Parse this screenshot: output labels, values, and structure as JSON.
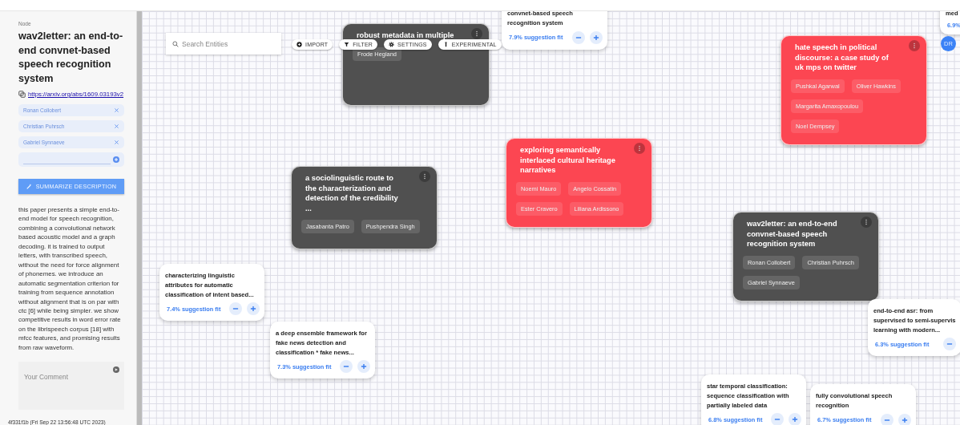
{
  "sidebar": {
    "label": "Node",
    "title": "wav2letter: an end-to-end convnet-based speech recognition system",
    "link": "https://arxiv.org/abs/1609.03193v2",
    "authors": [
      "Ronan Collobert",
      "Christian Puhrsch",
      "Gabriel Synnaeve"
    ],
    "summarize_button": "SUMMARIZE DESCRIPTION",
    "description": "this paper presents a simple end-to-end model for speech recognition, combining a convolutional network based acoustic model and a graph decoding. it is trained to output letters, with transcribed speech, without the need for force alignment of phonemes. we introduce an automatic segmentation criterion for training from sequence annotation without alignment that is on par with ctc [6] while being simpler. we show competitive results in word error rate on the librispeech corpus [18] with mfcc features, and promising results from raw waveform.",
    "comment_placeholder": "Your Comment"
  },
  "version": "4f331f1b (Fri Sep 22 13:56:48 UTC 2023)",
  "toolbar": {
    "search_placeholder": "Search Entities",
    "buttons": [
      {
        "kind": "import",
        "label": "IMPORT"
      },
      {
        "kind": "filter",
        "label": "FILTER"
      },
      {
        "kind": "settings",
        "label": "SETTINGS"
      },
      {
        "kind": "experimental",
        "label": "EXPERIMENTAL"
      }
    ]
  },
  "user_avatar": "DR",
  "nodes": [
    {
      "kind": "paper",
      "color": "#505050",
      "title": "robust metadata in multiple",
      "authors": [
        "Frode Hegland"
      ]
    },
    {
      "kind": "suggestion",
      "title": "convnet-based speech recognition system",
      "fit": "7.9% suggestion fit",
      "buttons": [
        {
          "kind": "minus"
        },
        {
          "kind": "plus"
        }
      ]
    },
    {
      "kind": "suggestion",
      "title": "med",
      "fit": "6.9%"
    },
    {
      "kind": "paper",
      "color": "#fc4652",
      "title": "hate speech in political discourse: a case study of uk mps on twitter",
      "authors": [
        "Pushkal Agarwal",
        "Oliver Hawkins",
        "Margarita Amaxopoulou",
        "Noel Dempsey"
      ]
    },
    {
      "kind": "paper",
      "color": "#fc4652",
      "title": "exploring semantically interlaced cultural heritage narratives",
      "authors": [
        "Noemi Mauro",
        "Angelo Cossatin",
        "Ester Cravero",
        "Liliana Ardissono"
      ]
    },
    {
      "kind": "paper",
      "color": "#505050",
      "title": "a sociolinguistic route to the characterization and detection of the credibility ...",
      "authors": [
        "Jasabanta Patro",
        "Pushpendra Singh"
      ]
    },
    {
      "kind": "paper",
      "color": "#505050",
      "title": "wav2letter: an end-to-end convnet-based speech recognition system",
      "authors": [
        "Ronan Collobert",
        "Christian Puhrsch",
        "Gabriel Synnaeve"
      ]
    },
    {
      "kind": "suggestion",
      "title": "characterizing linguistic attributes for automatic classification of intent based...",
      "fit": "7.4% suggestion fit",
      "buttons": [
        {
          "kind": "minus"
        },
        {
          "kind": "plus"
        }
      ]
    },
    {
      "kind": "suggestion",
      "title": "a deep ensemble framework for fake news detection and classification * fake news...",
      "fit": "7.3% suggestion fit",
      "buttons": [
        {
          "kind": "minus"
        },
        {
          "kind": "plus"
        }
      ]
    },
    {
      "kind": "suggestion",
      "title": "end-to-end asr: from supervised to semi-supervis learning with modern...",
      "fit": "6.3% suggestion fit",
      "buttons": [
        {
          "kind": "minus"
        }
      ]
    },
    {
      "kind": "suggestion",
      "title": "star temporal classification: sequence classification with partially labeled data",
      "fit": "6.8% suggestion fit",
      "buttons": [
        {
          "kind": "minus"
        },
        {
          "kind": "plus"
        }
      ]
    },
    {
      "kind": "suggestion",
      "title": "fully convolutional speech recognition",
      "fit": "6.7% suggestion fit",
      "buttons": [
        {
          "kind": "minus"
        },
        {
          "kind": "plus"
        }
      ]
    }
  ]
}
